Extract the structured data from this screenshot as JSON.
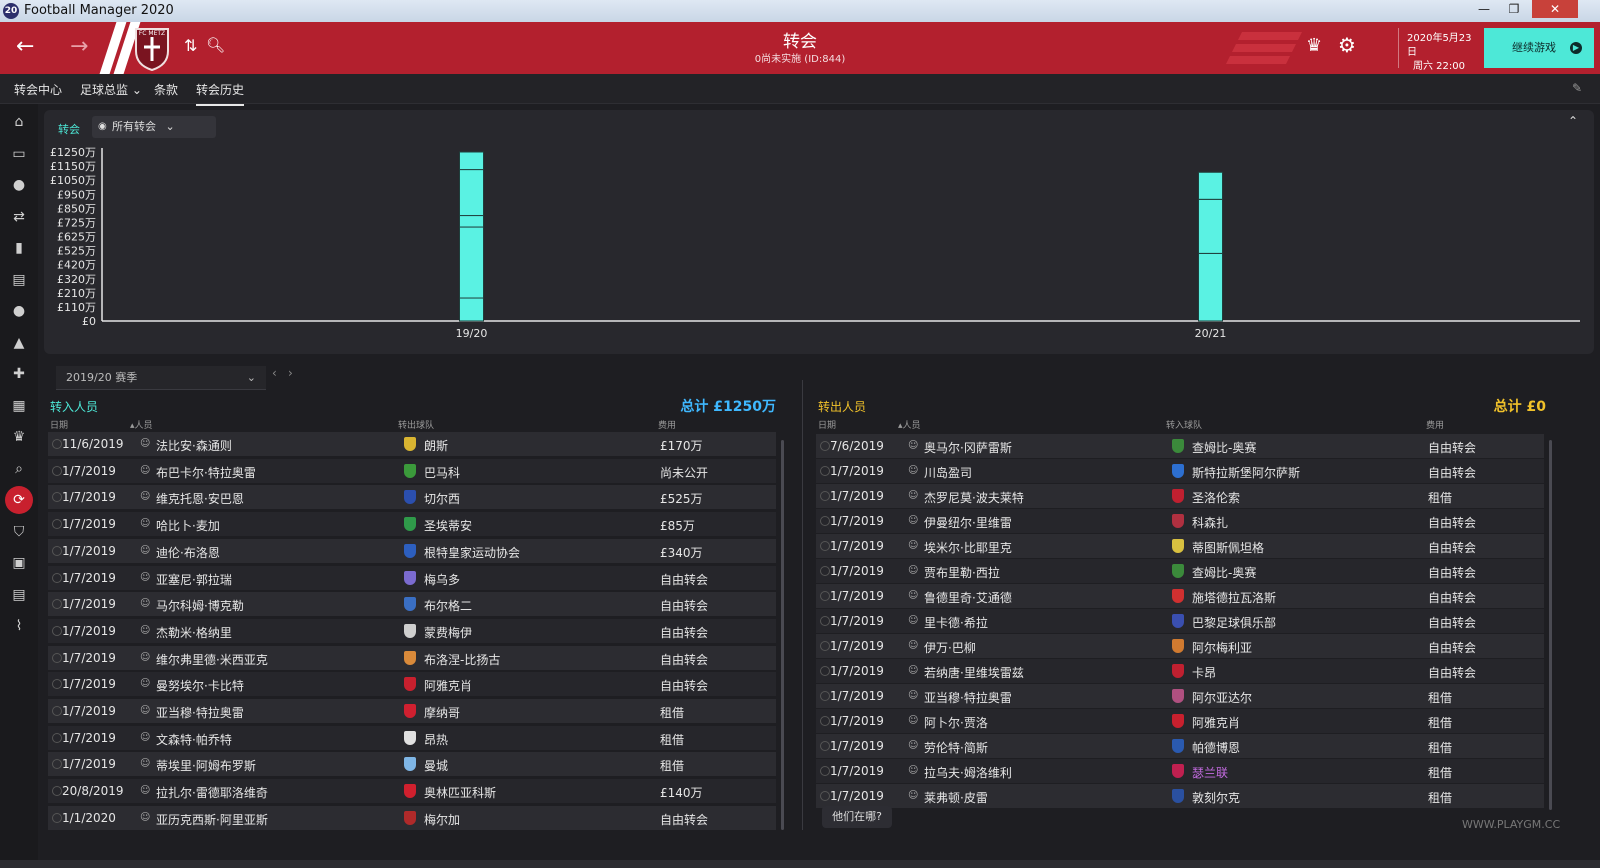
{
  "window": {
    "title": "Football Manager 2020",
    "icon_text": "20",
    "minimize": "—",
    "restore": "❐",
    "close": "✕"
  },
  "header": {
    "title": "转会",
    "subtitle": "0尚未实施 (ID:844)",
    "date_line1": "2020年5月23日",
    "date_line2": "周六 22:00",
    "continue_label": "继续游戏",
    "back_icon": "←",
    "forward_icon": "→",
    "updown_icon": "⇅",
    "search_icon": "🔍︎",
    "trophy_icon": "♛",
    "settings_icon": "⚙",
    "club_short": "FC METZ",
    "accent": "#b3202e",
    "continue_color": "#4de8d7"
  },
  "nav": {
    "items": [
      "转会中心",
      "足球总监 ⌄",
      "条款",
      "转会历史"
    ],
    "active_index": 3,
    "edit_icon": "✎"
  },
  "sidebar_icons": [
    "home-icon",
    "inbox-icon",
    "squad-icon",
    "transfers-icon",
    "report-icon",
    "clipboard-icon",
    "staff-icon",
    "tactics-icon",
    "medical-icon",
    "calendar-icon",
    "trophy-icon",
    "search-icon",
    "transfer-active-icon",
    "club-icon",
    "finance-icon",
    "schedule-icon",
    "analytics-icon"
  ],
  "chart": {
    "filter_label": "转会",
    "filter_value": "所有转会",
    "collapse_icon": "⌃"
  },
  "chart_data": {
    "type": "bar",
    "title": "",
    "categories": [
      "19/20",
      "20/21"
    ],
    "series": [
      {
        "values": [
          12.5,
          11.0
        ]
      }
    ],
    "segments": [
      [
        1.7,
        5.25,
        0.85,
        3.4,
        1.3
      ],
      [
        5.0,
        4.0,
        2.0
      ]
    ],
    "ytick_labels": [
      "£1250万",
      "£1150万",
      "£1050万",
      "£950万",
      "£850万",
      "£725万",
      "£625万",
      "£525万",
      "£420万",
      "£320万",
      "£210万",
      "£110万",
      "£0"
    ],
    "ylim": [
      0,
      12.5
    ],
    "unit": "£万",
    "bar_color": "#5af2e3"
  },
  "season": {
    "label": "2019/20 赛季",
    "chevron": "⌄",
    "prev": "‹",
    "next": "›"
  },
  "incoming": {
    "title": "转入人员",
    "total": "总计 £1250万",
    "total_color": "#3fb8ff",
    "columns": [
      "日期",
      "▴人员",
      "转出球队",
      "费用"
    ],
    "rows": [
      {
        "date": "11/6/2019",
        "player": "法比安·森通则",
        "club": "朗斯",
        "fee": "£170万",
        "crest": "#d8b431"
      },
      {
        "date": "1/7/2019",
        "player": "布巴卡尔·特拉奥雷",
        "club": "巴马科",
        "fee": "尚未公开",
        "crest": "#3b9a3b"
      },
      {
        "date": "1/7/2019",
        "player": "维克托恩·安巴恩",
        "club": "切尔西",
        "fee": "£525万",
        "crest": "#2b4fae"
      },
      {
        "date": "1/7/2019",
        "player": "哈比卜·麦加",
        "club": "圣埃蒂安",
        "fee": "£85万",
        "crest": "#2f9a4a"
      },
      {
        "date": "1/7/2019",
        "player": "迪伦·布洛恩",
        "club": "根特皇家运动协会",
        "fee": "£340万",
        "crest": "#2d5fbf"
      },
      {
        "date": "1/7/2019",
        "player": "亚塞尼·郭拉瑞",
        "club": "梅乌多",
        "fee": "自由转会",
        "crest": "#7b6bd0"
      },
      {
        "date": "1/7/2019",
        "player": "马尔科姆·博克勒",
        "club": "布尔格二",
        "fee": "自由转会",
        "crest": "#3a6fc4"
      },
      {
        "date": "1/7/2019",
        "player": "杰勒米·格纳里",
        "club": "蒙费梅伊",
        "fee": "自由转会",
        "crest": "#cfcfcf"
      },
      {
        "date": "1/7/2019",
        "player": "维尔弗里德·米西亚克",
        "club": "布洛涅-比扬古",
        "fee": "自由转会",
        "crest": "#d98a3a"
      },
      {
        "date": "1/7/2019",
        "player": "曼努埃尔·卡比特",
        "club": "阿雅克肖",
        "fee": "自由转会",
        "crest": "#c8202e"
      },
      {
        "date": "1/7/2019",
        "player": "亚当穆·特拉奥雷",
        "club": "摩纳哥",
        "fee": "租借",
        "crest": "#d02030"
      },
      {
        "date": "1/7/2019",
        "player": "文森特·帕乔特",
        "club": "昂热",
        "fee": "租借",
        "crest": "#e0e0e0"
      },
      {
        "date": "1/7/2019",
        "player": "蒂埃里·阿姆布罗斯",
        "club": "曼城",
        "fee": "租借",
        "crest": "#7fb6e6"
      },
      {
        "date": "20/8/2019",
        "player": "拉扎尔·雷德耶洛维奇",
        "club": "奥林匹亚科斯",
        "fee": "£140万",
        "crest": "#d0202e"
      },
      {
        "date": "1/1/2020",
        "player": "亚历克西斯·阿里亚斯",
        "club": "梅尔加",
        "fee": "自由转会",
        "crest": "#b02a2a"
      }
    ]
  },
  "outgoing": {
    "title": "转出人员",
    "total": "总计 £0",
    "total_color": "#f0c12a",
    "columns": [
      "日期",
      "▴人员",
      "转入球队",
      "费用"
    ],
    "rows": [
      {
        "date": "7/6/2019",
        "player": "奥马尔·冈萨雷斯",
        "club": "查姆比-奥赛",
        "fee": "自由转会",
        "crest": "#3b8a3b",
        "purple": false
      },
      {
        "date": "1/7/2019",
        "player": "川岛盈司",
        "club": "斯特拉斯堡阿尔萨斯",
        "fee": "自由转会",
        "crest": "#2d6fd0",
        "purple": false
      },
      {
        "date": "1/7/2019",
        "player": "杰罗尼莫·波夫莱特",
        "club": "圣洛伦索",
        "fee": "租借",
        "crest": "#c02030",
        "purple": false
      },
      {
        "date": "1/7/2019",
        "player": "伊曼纽尔·里维雷",
        "club": "科森扎",
        "fee": "自由转会",
        "crest": "#b03040",
        "purple": false
      },
      {
        "date": "1/7/2019",
        "player": "埃米尔·比耶里克",
        "club": "蒂图斯佩坦格",
        "fee": "自由转会",
        "crest": "#d8c040",
        "purple": false
      },
      {
        "date": "1/7/2019",
        "player": "贾布里勒·西拉",
        "club": "查姆比-奥赛",
        "fee": "自由转会",
        "crest": "#3b8a3b",
        "purple": false
      },
      {
        "date": "1/7/2019",
        "player": "鲁德里奇·艾通德",
        "club": "施塔德拉瓦洛斯",
        "fee": "自由转会",
        "crest": "#d03030",
        "purple": false
      },
      {
        "date": "1/7/2019",
        "player": "里卡德·希拉",
        "club": "巴黎足球俱乐部",
        "fee": "自由转会",
        "crest": "#3a4fb0",
        "purple": false
      },
      {
        "date": "1/7/2019",
        "player": "伊万·巴柳",
        "club": "阿尔梅利亚",
        "fee": "自由转会",
        "crest": "#d07a30",
        "purple": false
      },
      {
        "date": "1/7/2019",
        "player": "若纳唐·里维埃雷兹",
        "club": "卡昂",
        "fee": "自由转会",
        "crest": "#c02030",
        "purple": false
      },
      {
        "date": "1/7/2019",
        "player": "亚当穆·特拉奥雷",
        "club": "阿尔亚达尔",
        "fee": "租借",
        "crest": "#b05080",
        "purple": false
      },
      {
        "date": "1/7/2019",
        "player": "阿卜尔·贾洛",
        "club": "阿雅克肖",
        "fee": "租借",
        "crest": "#c8202e",
        "purple": false
      },
      {
        "date": "1/7/2019",
        "player": "劳伦特·简斯",
        "club": "帕德博恩",
        "fee": "租借",
        "crest": "#2a5ab0",
        "purple": false
      },
      {
        "date": "1/7/2019",
        "player": "拉乌夫·姆洛维利",
        "club": "瑟兰联",
        "fee": "租借",
        "crest": "#c02050",
        "purple": true
      },
      {
        "date": "1/7/2019",
        "player": "莱弗顿·皮雷",
        "club": "敦刻尔克",
        "fee": "租借",
        "crest": "#2a50a0",
        "purple": false
      }
    ]
  },
  "where_button": "他们在哪?",
  "watermark": "WWW.PLAYGM.CC"
}
